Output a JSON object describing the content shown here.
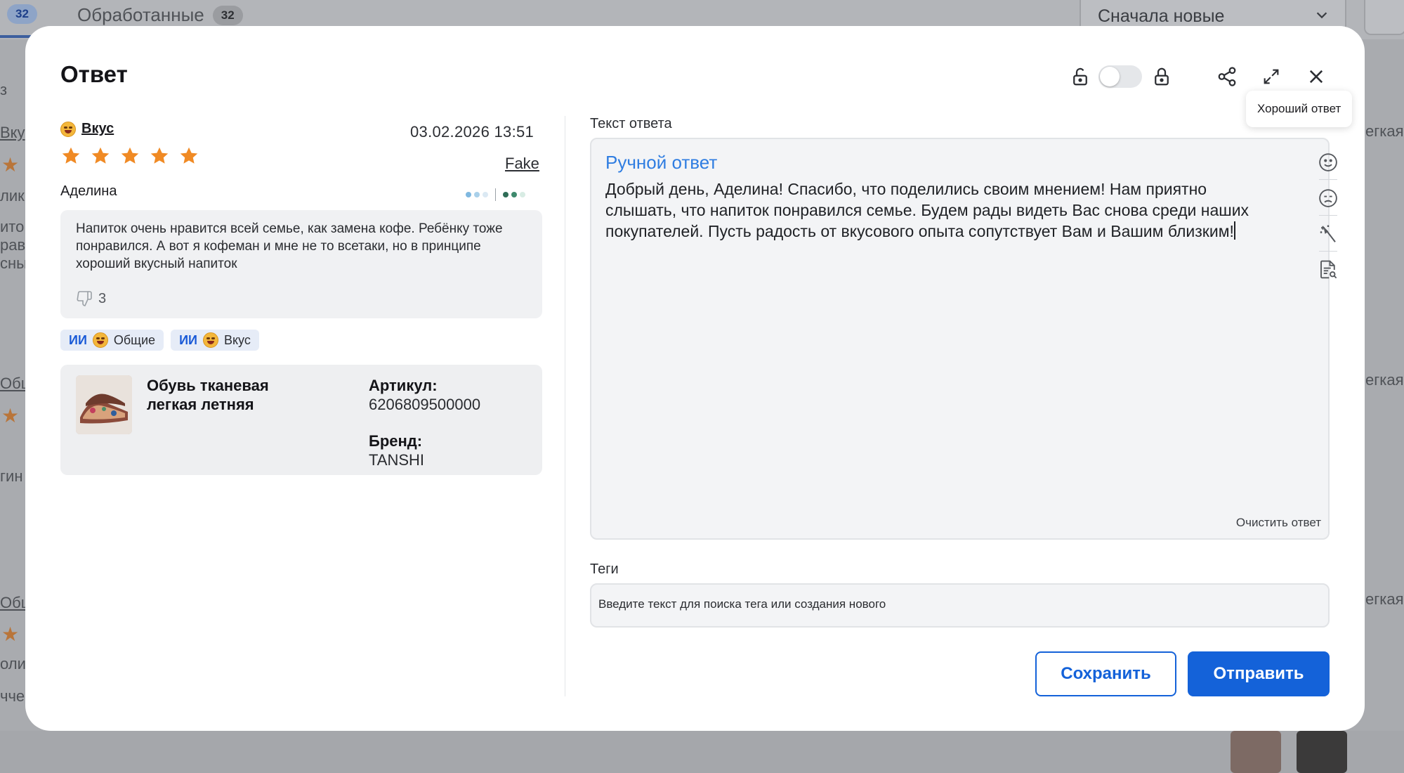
{
  "background": {
    "tabs": [
      {
        "label": "",
        "count": "32"
      },
      {
        "label": "Обработанные",
        "count": "32"
      }
    ],
    "sort_select": "Сначала новые",
    "side_fragments": [
      "з",
      "Вку",
      "лик",
      "ито",
      "рав",
      "сны",
      "Общ",
      "гин",
      "Общ",
      "оли",
      "ччес"
    ],
    "right_fragments": [
      "егкая",
      "егкая",
      "егкая"
    ]
  },
  "modal": {
    "title": "Ответ",
    "tooltip": "Хороший ответ",
    "review": {
      "tag": "Вкус",
      "date": "03.02.2026 13:51",
      "rating": 5,
      "rating_max": 5,
      "fake_label": "Fake",
      "author": "Аделина",
      "text": "Напиток очень нравится всей семье, как замена кофе. Ребёнку тоже понравился. А вот я кофеман и мне не то всетаки, но в принципе хороший вкусный напиток",
      "dislikes": "3"
    },
    "chips": [
      {
        "ai": "ИИ",
        "label": "Общие"
      },
      {
        "ai": "ИИ",
        "label": "Вкус"
      }
    ],
    "product": {
      "name": "Обувь тканевая легкая летняя",
      "article_label": "Артикул:",
      "article_value": "6206809500000",
      "brand_label": "Бренд:",
      "brand_value": "TANSHI"
    },
    "answer": {
      "label": "Текст ответа",
      "type": "Ручной ответ",
      "text": "Добрый день, Аделина! Спасибо, что поделились своим мнением! Нам приятно слышать, что напиток понравился семье. Будем рады видеть Вас снова среди наших покупателей. Пусть радость от вкусового опыта сопутствует Вам и Вашим близким!",
      "clear": "Очистить ответ"
    },
    "tags": {
      "label": "Теги",
      "placeholder": "Введите текст для поиска тега или создания нового"
    },
    "buttons": {
      "save": "Сохранить",
      "send": "Отправить"
    }
  },
  "colors": {
    "accent": "#1462d9",
    "star": "#f08a24",
    "answer_type": "#2f7de1"
  }
}
